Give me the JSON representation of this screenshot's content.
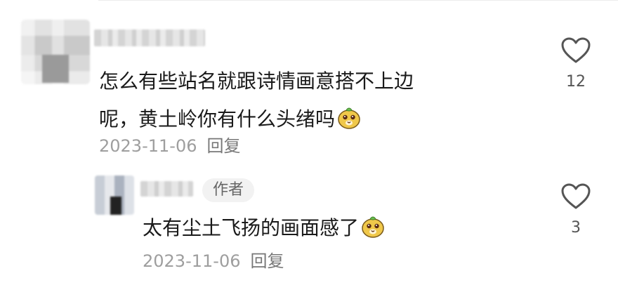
{
  "comments": [
    {
      "text_line1": "怎么有些站名就跟诗情画意搭不上边",
      "text_line2": "呢，黄土岭你有什么头绪吗",
      "date": "2023-11-06",
      "reply_label": "回复",
      "like_count": "12"
    },
    {
      "badge": "作者",
      "text": "太有尘土飞扬的画面感了",
      "date": "2023-11-06",
      "reply_label": "回复",
      "like_count": "3"
    }
  ],
  "icons": {
    "like": "heart-outline-icon",
    "emoji": "dog-face-emoji-icon"
  },
  "colors": {
    "text": "#1a1a1a",
    "meta": "#9e9e9e",
    "badge_bg": "#f2f2f2",
    "emoji": "#f0c84a"
  }
}
